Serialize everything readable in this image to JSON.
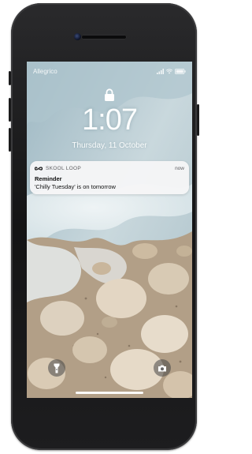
{
  "status_bar": {
    "carrier": "Allegrico",
    "battery": ""
  },
  "lock_screen": {
    "time": "1:07",
    "date": "Thursday, 11 October"
  },
  "notification": {
    "app_name": "SKOOL LOOP",
    "timestamp": "now",
    "title": "Reminder",
    "message": "'Chilly Tuesday' is on tomorrow"
  },
  "icons": {
    "lock": "padlock-icon",
    "flashlight": "flashlight-icon",
    "camera": "camera-icon",
    "app": "skool-loop-app-icon"
  }
}
